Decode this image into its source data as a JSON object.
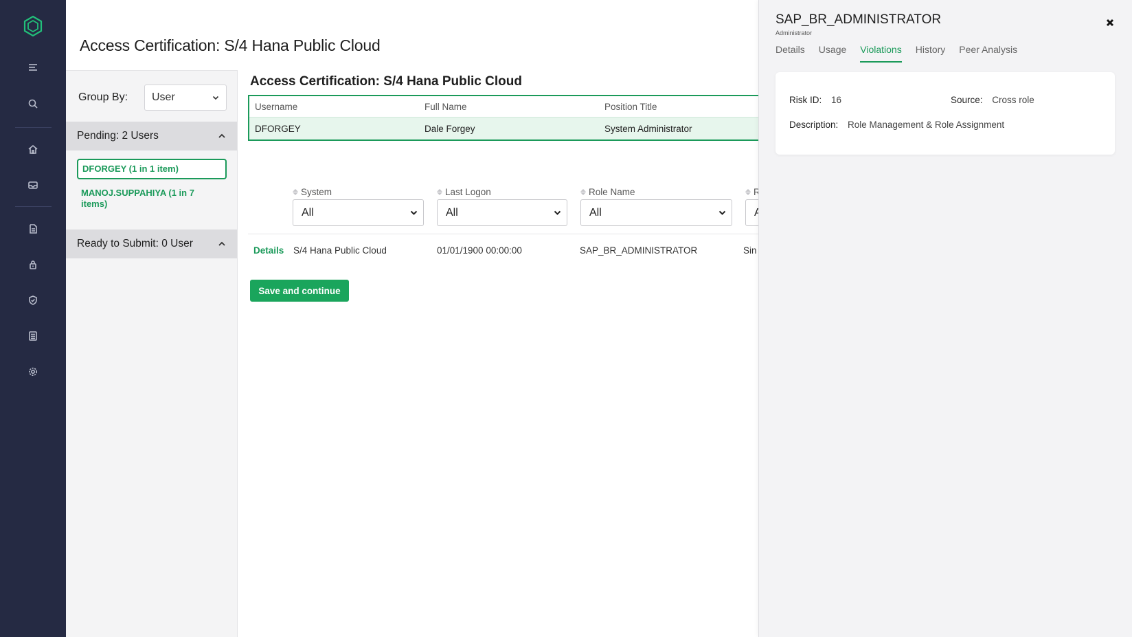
{
  "page": {
    "title": "Access Certification: S/4 Hana Public Cloud"
  },
  "colors": {
    "accent": "#1b9a5a",
    "rail": "#252a43"
  },
  "nav": {
    "items": [
      "menu-icon",
      "search-icon",
      "home-icon",
      "inbox-icon",
      "document-icon",
      "lock-icon",
      "shield-check-icon",
      "report-icon",
      "gear-icon"
    ]
  },
  "sidebar": {
    "group_by_label": "Group By:",
    "group_by_value": "User",
    "pending_header": "Pending: 2 Users",
    "users": [
      {
        "label": "DFORGEY (1 in 1 item)",
        "active": true
      },
      {
        "label": "MANOJ.SUPPAHIYA (1 in 7 items)",
        "active": false
      }
    ],
    "ready_header": "Ready to Submit: 0 User"
  },
  "main": {
    "title": "Access Certification: S/4 Hana Public Cloud",
    "user_table": {
      "headers": [
        "Username",
        "Full Name",
        "Position Title"
      ],
      "row": [
        "DFORGEY",
        "Dale Forgey",
        "System Administrator"
      ]
    },
    "filters": [
      {
        "label": "System",
        "value": "All"
      },
      {
        "label": "Last Logon",
        "value": "All"
      },
      {
        "label": "Role Name",
        "value": "All"
      },
      {
        "label": "R",
        "value": "A"
      }
    ],
    "row": {
      "details": "Details",
      "system": "S/4 Hana Public Cloud",
      "last_logon": "01/01/1900 00:00:00",
      "role_name": "SAP_BR_ADMINISTRATOR",
      "extra": "Sin"
    },
    "save_label": "Save and continue"
  },
  "drawer": {
    "title": "SAP_BR_ADMINISTRATOR",
    "subtitle": "Administrator",
    "tabs": [
      "Details",
      "Usage",
      "Violations",
      "History",
      "Peer Analysis"
    ],
    "active_tab": "Violations",
    "risk_id_label": "Risk ID:",
    "risk_id_value": "16",
    "source_label": "Source:",
    "source_value": "Cross role",
    "description_label": "Description:",
    "description_value": "Role Management & Role Assignment"
  }
}
